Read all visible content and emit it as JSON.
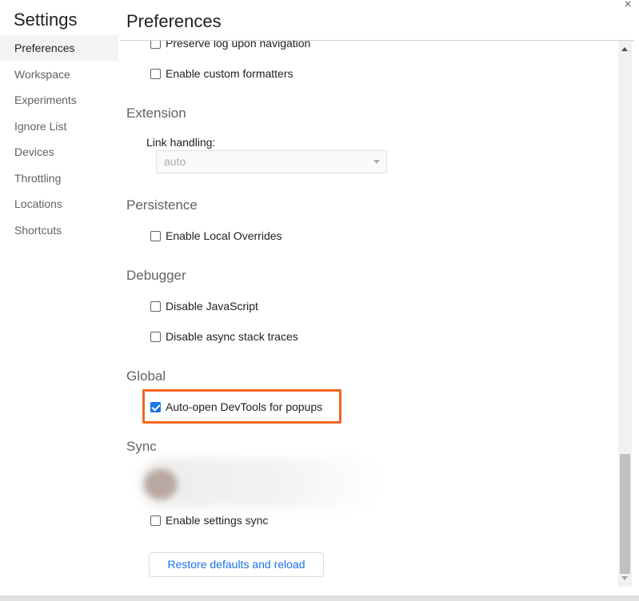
{
  "sidebar": {
    "title": "Settings",
    "items": [
      {
        "label": "Preferences"
      },
      {
        "label": "Workspace"
      },
      {
        "label": "Experiments"
      },
      {
        "label": "Ignore List"
      },
      {
        "label": "Devices"
      },
      {
        "label": "Throttling"
      },
      {
        "label": "Locations"
      },
      {
        "label": "Shortcuts"
      }
    ],
    "active": "Preferences"
  },
  "header": {
    "title": "Preferences",
    "close_icon": "×"
  },
  "content": {
    "console": {
      "preserve_log": {
        "label": "Preserve log upon navigation",
        "checked": false
      },
      "custom_formatters": {
        "label": "Enable custom formatters",
        "checked": false
      }
    },
    "extension": {
      "header": "Extension",
      "link_handling_label": "Link handling:",
      "link_handling_value": "auto"
    },
    "persistence": {
      "header": "Persistence",
      "local_overrides": {
        "label": "Enable Local Overrides",
        "checked": false
      }
    },
    "debugger": {
      "header": "Debugger",
      "disable_js": {
        "label": "Disable JavaScript",
        "checked": false
      },
      "disable_async": {
        "label": "Disable async stack traces",
        "checked": false
      }
    },
    "global": {
      "header": "Global",
      "auto_open": {
        "label": "Auto-open DevTools for popups",
        "checked": true
      }
    },
    "sync": {
      "header": "Sync",
      "enable_sync": {
        "label": "Enable settings sync",
        "checked": false
      }
    },
    "restore_button": "Restore defaults and reload"
  },
  "colors": {
    "accent": "#1a73e8",
    "highlight": "#f26522"
  }
}
